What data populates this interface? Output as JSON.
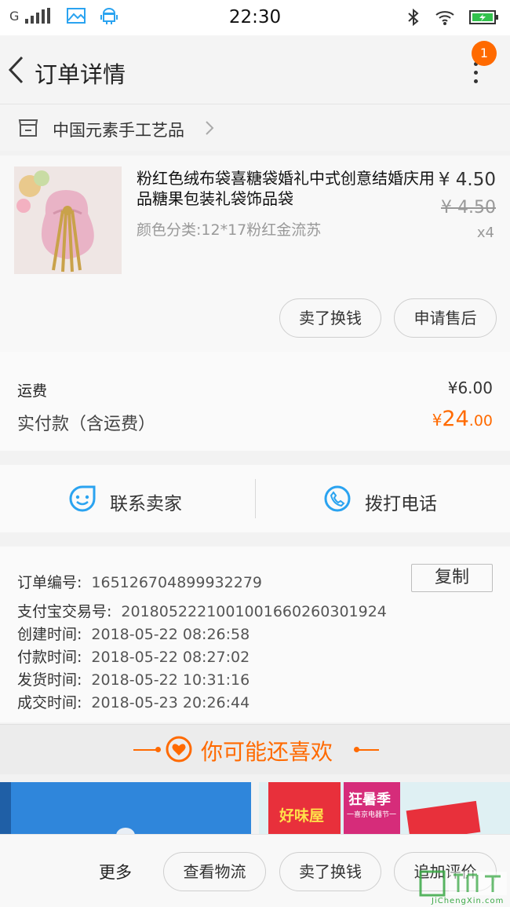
{
  "status_bar": {
    "network": "G",
    "time": "22:30"
  },
  "nav": {
    "title": "订单详情",
    "badge_count": "1"
  },
  "shop": {
    "name": "中国元素手工艺品"
  },
  "product": {
    "title": "粉红色绒布袋喜糖袋婚礼中式创意结婚庆用品糖果包装礼袋饰品袋",
    "sku": "颜色分类:12*17粉红金流苏",
    "price": "¥ 4.50",
    "original_price": "¥ 4.50",
    "quantity": "x4",
    "sell_button": "卖了换钱",
    "after_sale_button": "申请售后"
  },
  "fees": {
    "shipping_label": "运费",
    "shipping_value": "¥6.00",
    "total_label": "实付款（含运费）",
    "total_currency": "¥",
    "total_integer": "24",
    "total_decimal": ".00"
  },
  "contact": {
    "seller_label": "联系卖家",
    "call_label": "拨打电话"
  },
  "order_info": {
    "order_no_label": "订单编号:",
    "order_no": "165126704899932279",
    "copy_button": "复制",
    "alipay_label": "支付宝交易号:",
    "alipay_no": "2018052221001001660260301924",
    "created_label": "创建时间:",
    "created": "2018-05-22 08:26:58",
    "paid_label": "付款时间:",
    "paid": "2018-05-22 08:27:02",
    "shipped_label": "发货时间:",
    "shipped": "2018-05-22 10:31:16",
    "completed_label": "成交时间:",
    "completed": "2018-05-23 20:26:44"
  },
  "recommend": {
    "title": "你可能还喜欢",
    "card2_brand": "好味屋",
    "card2_tag": "狂暑季",
    "card2_sub": "一喜京电器节一"
  },
  "bottom_bar": {
    "more": "更多",
    "logistics_button": "查看物流",
    "sell_button": "卖了换钱",
    "review_button": "追加评价"
  },
  "watermark": {
    "site": "JiChengXin.com"
  },
  "colors": {
    "accent": "#ff6a00",
    "contact_icon": "#2aa3f0"
  }
}
